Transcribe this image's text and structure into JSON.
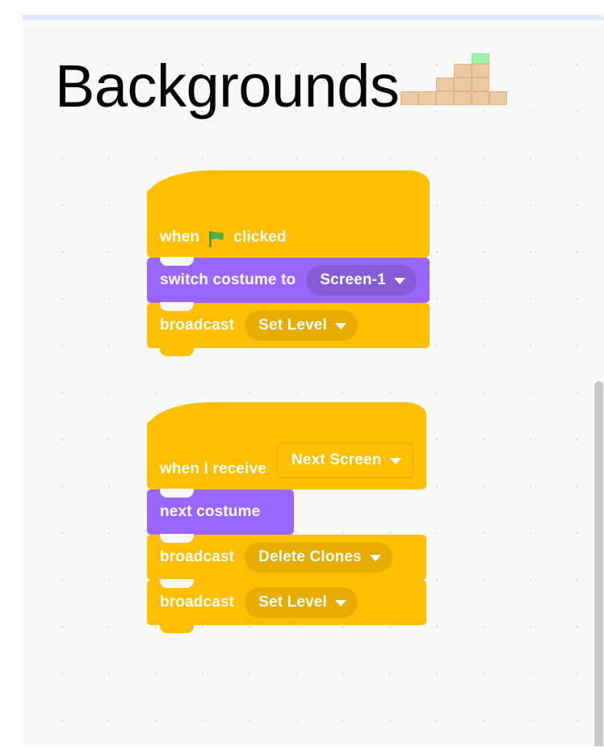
{
  "page": {
    "title": "Backgrounds",
    "background_color": "#f9f9f9",
    "top_border_color": "#e0e7f8"
  },
  "terrain_art": {
    "name": "pixel-terrain",
    "ground_tile_color": "#ecc9a0",
    "grass_tile_color": "#9ef2a5"
  },
  "scrollbar": {
    "name": "vertical-scrollbar",
    "thumb_color": "#c9c9c9"
  },
  "palette": {
    "events": "#ffbf00",
    "events_input": "#e6ac00",
    "looks": "#9966ff",
    "looks_input": "#855cd6",
    "flag_green": "#4caf50"
  },
  "scripts": [
    {
      "name": "green-flag-script",
      "blocks": [
        {
          "type": "hat",
          "category": "events",
          "name": "when-green-flag-clicked-block",
          "text_before": "when",
          "icon": "green-flag-icon",
          "text_after": "clicked"
        },
        {
          "type": "stack",
          "category": "looks",
          "name": "switch-costume-to-block",
          "label": "switch costume to",
          "dropdown": {
            "value": "Screen-1",
            "style": "filled"
          }
        },
        {
          "type": "stack",
          "category": "events",
          "name": "broadcast-block",
          "label": "broadcast",
          "dropdown": {
            "value": "Set Level",
            "style": "filled"
          }
        }
      ]
    },
    {
      "name": "when-i-receive-script",
      "blocks": [
        {
          "type": "hat",
          "category": "events",
          "name": "when-i-receive-block",
          "label": "when I receive",
          "dropdown": {
            "value": "Next Screen",
            "style": "outline"
          }
        },
        {
          "type": "stack",
          "category": "looks",
          "name": "next-costume-block",
          "label": "next costume"
        },
        {
          "type": "stack",
          "category": "events",
          "name": "broadcast-block",
          "label": "broadcast",
          "dropdown": {
            "value": "Delete Clones",
            "style": "filled"
          }
        },
        {
          "type": "stack",
          "category": "events",
          "name": "broadcast-block",
          "label": "broadcast",
          "dropdown": {
            "value": "Set Level",
            "style": "filled"
          }
        }
      ]
    }
  ]
}
